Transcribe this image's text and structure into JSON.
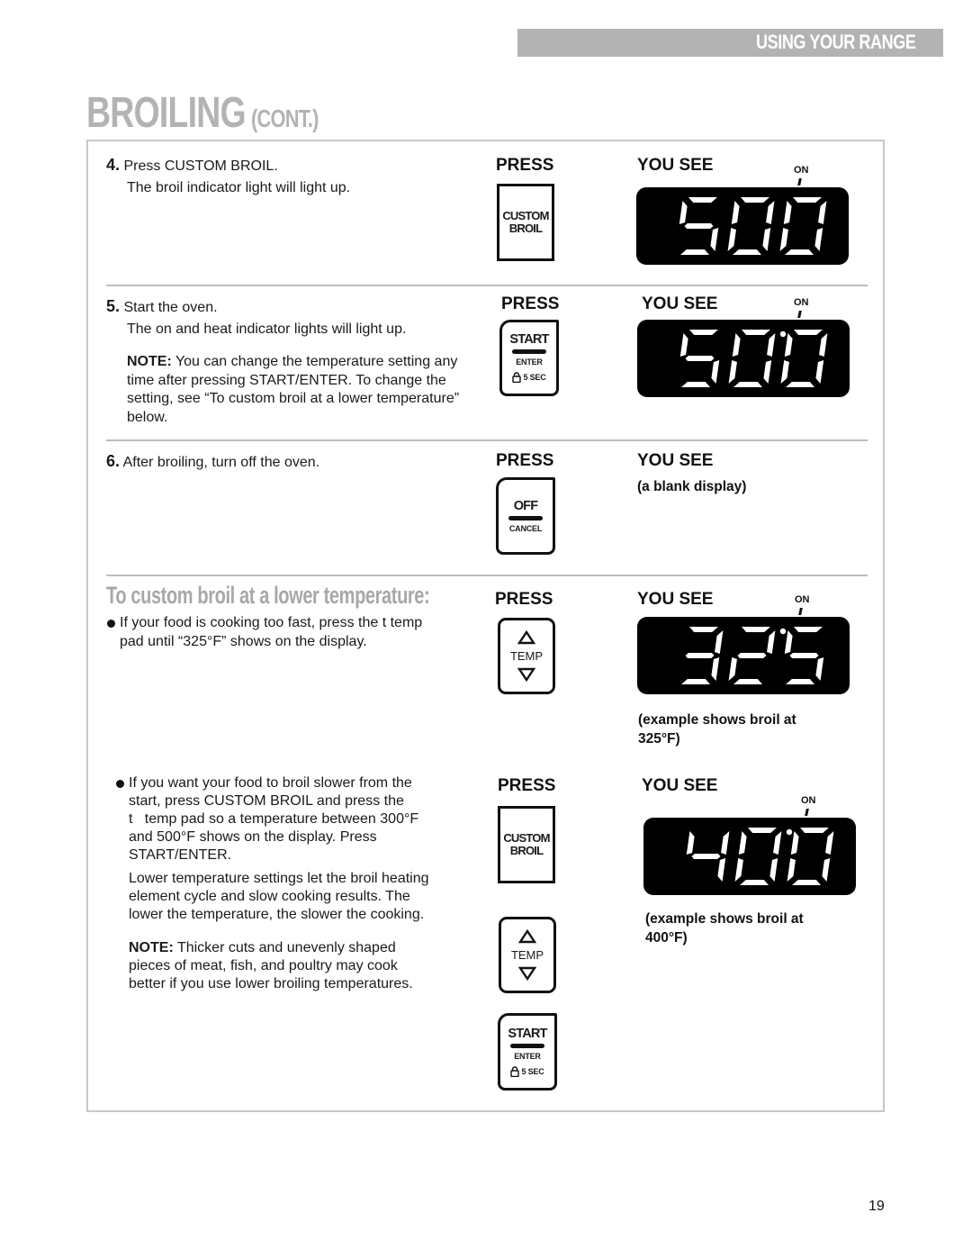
{
  "header": {
    "section_label": "USING YOUR RANGE",
    "title_main": "BROILING",
    "title_suffix": "(CONT.)"
  },
  "columns": {
    "press": "PRESS",
    "you_see": "YOU SEE"
  },
  "steps": [
    {
      "number": "4.",
      "text": "Press CUSTOM BROIL.",
      "detail": "The broil indicator light will light up.",
      "press_button": {
        "icon": "custom-broil-button",
        "line1": "CUSTOM",
        "line2": "BROIL"
      },
      "display": {
        "value": "500",
        "on_indicator": "ON",
        "colon_dot": false
      }
    },
    {
      "number": "5.",
      "text": "Start the oven.",
      "detail": "The on and heat indicator lights will light up.",
      "note_label": "NOTE:",
      "note_text": " You can change the temperature setting any time after pressing START/ENTER. To change the setting, see “To custom broil at a lower temperature” below.",
      "press_button": {
        "icon": "start-enter-button",
        "main": "START",
        "sub": "ENTER",
        "lock": "5 SEC"
      },
      "display": {
        "value": "500",
        "on_indicator": "ON",
        "colon_dot": true
      }
    },
    {
      "number": "6.",
      "text": "After broiling, turn off the oven.",
      "press_button": {
        "icon": "off-cancel-button",
        "main": "OFF",
        "sub": "CANCEL"
      },
      "display_text": "(a blank display)"
    }
  ],
  "lower_temp": {
    "title": "To custom broil at a lower temperature:",
    "bullet1": {
      "text": "If your food is cooking too fast, press the t   temp pad until “325°F” shows on the display.",
      "line1": "If your food is cooking too fast, press the t   temp",
      "line2": "pad until “325°F” shows on the display.",
      "press_button": {
        "icon": "temp-up-down-button",
        "label": "TEMP"
      },
      "display": {
        "value": "325",
        "on_indicator": "ON",
        "colon_dot": true
      },
      "caption": "(example shows broil at 325°F)",
      "caption_line1": "(example shows broil at",
      "caption_line2": "325°F)"
    },
    "bullet2": {
      "lines": [
        "If you want your food to broil slower from the",
        "start, press CUSTOM BROIL and press the",
        "t   temp pad so a temperature between 300°F",
        "and 500°F shows on the display. Press",
        "START/ENTER."
      ],
      "para_lines": [
        "Lower temperature settings let the broil heating",
        "element cycle and slow cooking results. The",
        "lower the temperature, the slower the cooking."
      ],
      "note_label": "NOTE:",
      "note_lines": [
        " Thicker cuts and unevenly shaped",
        "pieces of meat, fish, and poultry may cook",
        "better if you use lower broiling temperatures."
      ],
      "press_buttons": [
        {
          "icon": "custom-broil-button",
          "line1": "CUSTOM",
          "line2": "BROIL"
        },
        {
          "icon": "temp-up-down-button",
          "label": "TEMP"
        },
        {
          "icon": "start-enter-button",
          "main": "START",
          "sub": "ENTER",
          "lock": "5 SEC"
        }
      ],
      "display": {
        "value": "400",
        "on_indicator": "ON",
        "colon_dot": true
      },
      "caption_line1": "(example shows broil at",
      "caption_line2": "400°F)"
    }
  },
  "page_number": "19"
}
